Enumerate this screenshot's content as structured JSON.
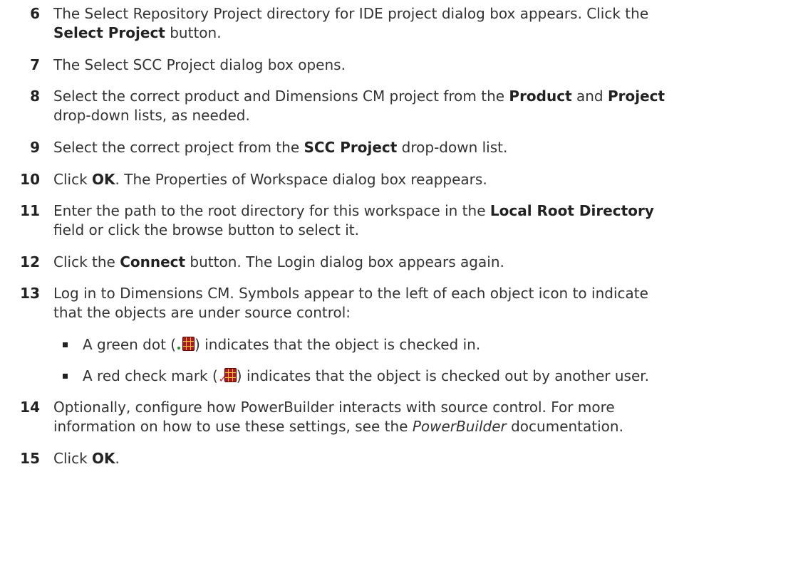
{
  "steps": [
    {
      "num": "6",
      "lines": [
        [
          {
            "t": "The Select Repository Project directory for IDE project dialog box appears. Click the"
          }
        ],
        [
          {
            "t": "Select Project",
            "b": true
          },
          {
            "t": " button."
          }
        ]
      ]
    },
    {
      "num": "7",
      "lines": [
        [
          {
            "t": "The Select SCC Project dialog box opens."
          }
        ]
      ]
    },
    {
      "num": "8",
      "lines": [
        [
          {
            "t": "Select the correct product and Dimensions CM project from the "
          },
          {
            "t": "Product",
            "b": true
          },
          {
            "t": " and "
          },
          {
            "t": "Project",
            "b": true
          }
        ],
        [
          {
            "t": "drop-down lists, as needed."
          }
        ]
      ]
    },
    {
      "num": "9",
      "lines": [
        [
          {
            "t": "Select the correct project from the "
          },
          {
            "t": "SCC Project",
            "b": true
          },
          {
            "t": " drop-down list."
          }
        ]
      ]
    },
    {
      "num": "10",
      "lines": [
        [
          {
            "t": "Click "
          },
          {
            "t": "OK",
            "b": true
          },
          {
            "t": ". The Properties of Workspace dialog box reappears."
          }
        ]
      ]
    },
    {
      "num": "11",
      "lines": [
        [
          {
            "t": "Enter the path to the root directory for this workspace in the "
          },
          {
            "t": "Local Root Directory",
            "b": true
          }
        ],
        [
          {
            "t": "field or click the browse button to select it."
          }
        ]
      ]
    },
    {
      "num": "12",
      "lines": [
        [
          {
            "t": "Click the "
          },
          {
            "t": "Connect",
            "b": true
          },
          {
            "t": " button. The Login dialog box appears again."
          }
        ]
      ]
    },
    {
      "num": "13",
      "lines": [
        [
          {
            "t": "Log in to Dimensions CM. Symbols appear to the left of each object icon to indicate"
          }
        ],
        [
          {
            "t": "that the objects are under source control:"
          }
        ]
      ]
    },
    {
      "num": "14",
      "lines": [
        [
          {
            "t": "Optionally, configure how PowerBuilder interacts with source control. For more"
          }
        ],
        [
          {
            "t": "information on how to use these settings, see the "
          },
          {
            "t": "PowerBuilder",
            "i": true
          },
          {
            "t": " documentation."
          }
        ]
      ]
    },
    {
      "num": "15",
      "lines": [
        [
          {
            "t": "Click "
          },
          {
            "t": "OK",
            "b": true
          },
          {
            "t": "."
          }
        ]
      ]
    }
  ],
  "bullets": [
    {
      "before": "A green dot (",
      "icon": "checked-in-object-icon",
      "after": ") indicates that the object is checked in."
    },
    {
      "before": "A red check mark (",
      "icon": "checked-out-object-icon",
      "after": ") indicates that the object is checked out by another user."
    }
  ],
  "colors": {
    "text": "#333333",
    "dot": "#1a9a1a",
    "check": "#e02020",
    "object_icon": "#b11a1a"
  }
}
